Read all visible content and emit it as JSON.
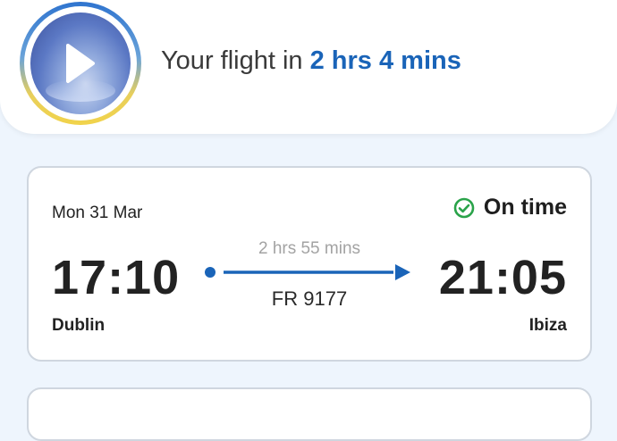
{
  "banner": {
    "headline_prefix": "Your flight in ",
    "headline_duration": "2 hrs 4 mins",
    "story_icon": "play-icon"
  },
  "flight": {
    "date": "Mon 31 Mar",
    "status": "On time",
    "status_icon": "check-circle-icon",
    "departure_time": "17:10",
    "arrival_time": "21:05",
    "departure_city": "Dublin",
    "arrival_city": "Ibiza",
    "duration": "2 hrs 55 mins",
    "flight_number": "FR 9177"
  },
  "colors": {
    "accent": "#1a64b8",
    "status_green": "#2aa34a",
    "background": "#eef5fd"
  }
}
